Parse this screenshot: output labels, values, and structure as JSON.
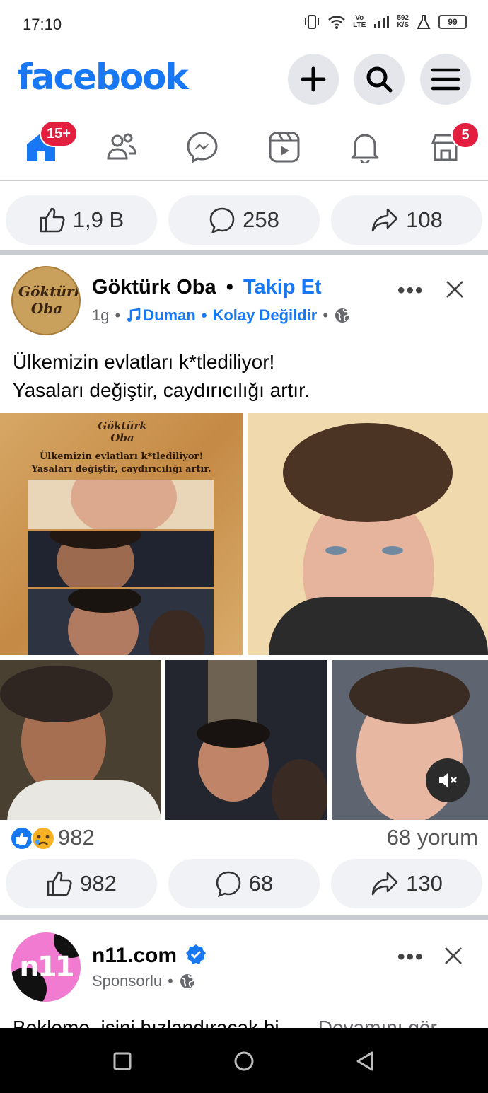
{
  "status": {
    "time": "17:10",
    "net_top": "Vo",
    "net_bottom": "LTE",
    "speed_top": "592",
    "speed_bottom": "K/S",
    "battery": "99"
  },
  "header": {
    "logo": "facebook"
  },
  "nav": {
    "home_badge": "15+",
    "marketplace_badge": "5"
  },
  "prev_post": {
    "likes": "1,9 B",
    "comments": "258",
    "shares": "108"
  },
  "post": {
    "author": "Göktürk Oba",
    "separator": "•",
    "follow_label": "Takip Et",
    "time": "1g",
    "music_artist": "Duman",
    "music_dot": "•",
    "music_song": "Kolay Değildir",
    "dot": "•",
    "more": "•••",
    "text_line1": "Ülkemizin evlatları k*tlediliyor!",
    "text_line2": "Yasaları değiştir, caydırıcılığı artır.",
    "poster_logo": "Göktürk Oba",
    "poster_line1": "Ülkemizin evlatları k*tlediliyor!",
    "poster_line2": "Yasaları değiştir, caydırıcılığı artır.",
    "reaction_count": "982",
    "comment_count": "68 yorum",
    "likes": "982",
    "comments": "68",
    "shares": "130",
    "avatar_text": "Göktürk Oba"
  },
  "sponsored": {
    "name": "n11.com",
    "label": "Sponsorlu",
    "dot": "•",
    "more": "•••",
    "avatar_text": "n11",
    "text": "Bekleme, işini hızlandıracak bi...",
    "see_more": "Devamını gör"
  },
  "colors": {
    "brand": "#1877f2",
    "badge": "#e41e3f",
    "pill": "#f0f2f5"
  }
}
